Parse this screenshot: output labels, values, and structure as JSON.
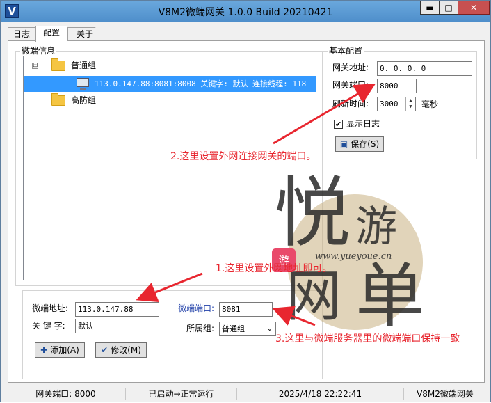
{
  "window": {
    "title": "V8M2微端网关 1.0.0 Build 20210421",
    "app_icon_letter": "V",
    "controls": {
      "minimize": "▬",
      "maximize": "□",
      "close": "✕"
    }
  },
  "tabs": [
    {
      "label": "日志",
      "active": false
    },
    {
      "label": "配置",
      "active": true
    },
    {
      "label": "关于",
      "active": false
    }
  ],
  "micro_info": {
    "legend": "微端信息",
    "tree": [
      {
        "label": "普通组",
        "expander": "⊟",
        "icon": "folder-icon"
      },
      {
        "label": "113.0.147.88:8081:8008 关键字: 默认 连接线程: 118",
        "icon": "monitor-icon",
        "selected": true
      },
      {
        "label": "高防组",
        "icon": "folder-icon"
      }
    ]
  },
  "basic_config": {
    "legend": "基本配置",
    "gateway_address_label": "网关地址:",
    "gateway_address_value": "0. 0. 0. 0",
    "gateway_port_label": "网关端口:",
    "gateway_port_value": "8000",
    "refresh_label": "刷新时间:",
    "refresh_value": "3000",
    "refresh_unit": "毫秒",
    "show_log_label": "显示日志",
    "show_log_checked": "✔",
    "save_label": "保存(S)"
  },
  "micro_form": {
    "address_label": "微端地址:",
    "address_value": "113.0.147.88",
    "keyword_label": "关 键 字:",
    "keyword_value": "默认",
    "port_label": "微端端口:",
    "port_value": "8081",
    "group_label": "所属组:",
    "group_value": "普通组",
    "add_label": "添加(A)",
    "modify_label": "修改(M)"
  },
  "annotations": {
    "note1": "1.这里设置外网地址即可。",
    "note2": "2.这里设置外网连接网关的端口。",
    "note3": "3.这里与微端服务器里的微端端口保持一致",
    "color": "#e8262f"
  },
  "watermark": {
    "line1": "悦",
    "line2": "游",
    "line3": "网",
    "line4": "单",
    "badge": "游",
    "url": "www.yueyoue.cn"
  },
  "statusbar": {
    "port": "网关端口: 8000",
    "state": "已启动→正常运行",
    "datetime": "2025/4/18 22:22:41",
    "app": "V8M2微端网关"
  }
}
